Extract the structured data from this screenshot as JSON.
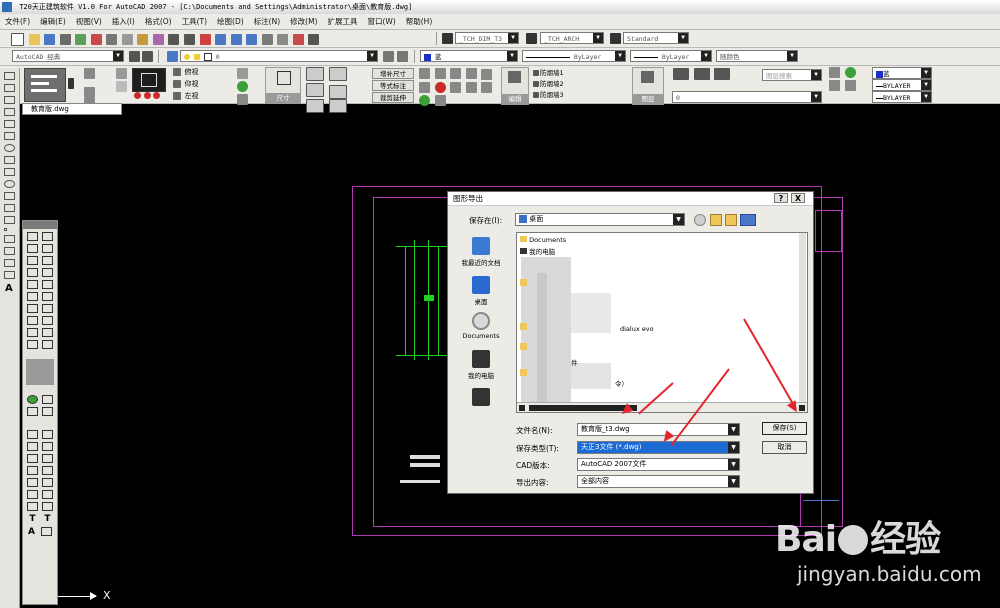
{
  "window": {
    "title": "T20天正建筑软件 V1.0 For AutoCAD 2007 - [C:\\Documents and Settings\\Administrator\\桌面\\教育版.dwg]"
  },
  "menu": [
    "文件(F)",
    "编辑(E)",
    "视图(V)",
    "插入(I)",
    "格式(O)",
    "工具(T)",
    "绘图(D)",
    "标注(N)",
    "修改(M)",
    "扩展工具",
    "窗口(W)",
    "帮助(H)"
  ],
  "toolbar": {
    "style_combo": "_TCH_DIM_T3",
    "dim_combo": "_TCH_ARCH",
    "table_combo": "Standard",
    "workspace_combo": "AutoCAD 经典",
    "layer_combo": "0",
    "color_combo": "蓝",
    "linetype_combo": "ByLayer",
    "lineweight_combo": "ByLayer",
    "plotstyle_combo": "随颜色",
    "right_combo_1": "蓝",
    "right_combo_2": "BYLAYER",
    "right_combo_3": "BYLAYER",
    "search_placeholder": "图层搜索",
    "layer_combo_2": "0"
  },
  "panels": {
    "view_items": [
      "俯视",
      "仰视",
      "左视"
    ],
    "dim_label": "尺寸",
    "dim_items": [
      "增补尺寸",
      "等式标注",
      "裁剪延伸"
    ],
    "layer_items": [
      "防烟墙1",
      "防烟墙2",
      "防烟墙3"
    ],
    "edit_label": "编辑",
    "layer_label": "图层"
  },
  "document_tab": "教育版.dwg",
  "dialog": {
    "title": "图形导出",
    "help_button": "?",
    "close_button": "X",
    "save_in_label": "保存在(I):",
    "save_in_value": "桌面",
    "places": [
      "我最近的文档",
      "桌面",
      "Documents",
      "我的电脑"
    ],
    "files": [
      "Documents",
      "我的电脑",
      "dialux evo",
      "件",
      "令）"
    ],
    "filename_label": "文件名(N):",
    "filename_value": "教育版_t3.dwg",
    "filetype_label": "保存类型(T):",
    "filetype_value": "天正3文件 (*.dwg)",
    "cad_version_label": "CAD版本:",
    "cad_version_value": "AutoCAD 2007文件",
    "export_label": "导出内容:",
    "export_value": "全部内容",
    "save_button": "保存(S)",
    "cancel_button": "取消"
  },
  "watermark": {
    "brand_latin": "Bai",
    "brand_cn": "经验",
    "url": "jingyan.baidu.com"
  },
  "colors": {
    "accent": "#e3262e",
    "drawing_border": "#b437b4",
    "drawing_lines": "#1fd21f"
  }
}
